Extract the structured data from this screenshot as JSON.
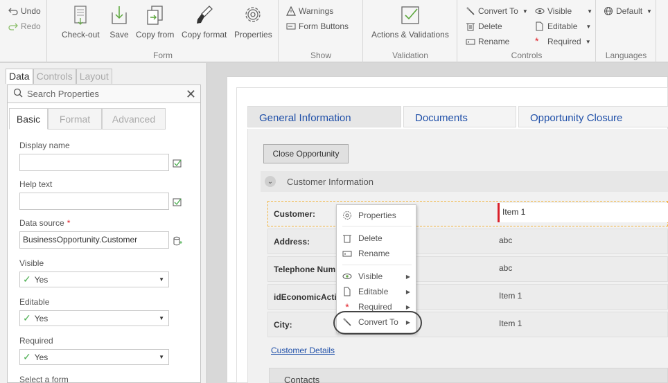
{
  "ribbon": {
    "undo": "Undo",
    "redo": "Redo",
    "form": {
      "title": "Form",
      "buttons": [
        "Check-out",
        "Save",
        "Copy from",
        "Copy format",
        "Properties"
      ]
    },
    "show": {
      "title": "Show",
      "warnings": "Warnings",
      "form_buttons": "Form Buttons"
    },
    "validation": {
      "title": "Validation",
      "actions": "Actions & Validations"
    },
    "controls": {
      "title": "Controls",
      "convert_to": "Convert To",
      "delete": "Delete",
      "rename": "Rename",
      "visible": "Visible",
      "editable": "Editable",
      "required": "Required"
    },
    "languages": {
      "title": "Languages",
      "default": "Default"
    }
  },
  "left_panel": {
    "tabs": [
      "Data",
      "Controls",
      "Layout"
    ],
    "search_placeholder": "Search Properties",
    "sub_tabs": [
      "Basic",
      "Format",
      "Advanced"
    ],
    "fields": {
      "display_name_label": "Display name",
      "display_name_value": "",
      "help_text_label": "Help text",
      "help_text_value": "",
      "data_source_label": "Data source",
      "data_source_value": "BusinessOpportunity.Customer",
      "visible_label": "Visible",
      "visible_value": "Yes",
      "editable_label": "Editable",
      "editable_value": "Yes",
      "required_label": "Required",
      "required_value": "Yes",
      "select_form_label": "Select a form"
    }
  },
  "form": {
    "tabs": [
      "General Information",
      "Documents",
      "Opportunity Closure"
    ],
    "close_button": "Close Opportunity",
    "section_title": "Customer Information",
    "rows": [
      {
        "label": "Customer:",
        "value": "Item 1"
      },
      {
        "label": "Address:",
        "value": "abc"
      },
      {
        "label": "Telephone Num",
        "value": "abc"
      },
      {
        "label": "idEconomicActiv",
        "value": "Item 1"
      },
      {
        "label": "City:",
        "value": "Item 1"
      }
    ],
    "link": "Customer Details",
    "contacts_title": "Contacts"
  },
  "context_menu": {
    "items": [
      "Properties",
      "Delete",
      "Rename",
      "Visible",
      "Editable",
      "Required",
      "Convert To"
    ]
  },
  "colors": {
    "link_blue": "#1f4fa8",
    "required_red": "#e01b24",
    "selection_orange": "#f1b33c"
  }
}
